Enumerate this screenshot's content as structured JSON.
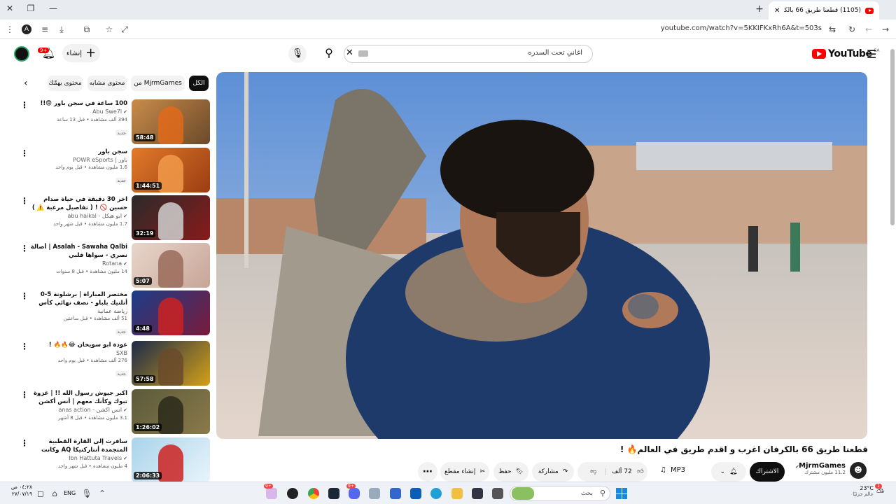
{
  "browser": {
    "tab_title": "(1105) قطعنا طريق 66 بالكرفان",
    "url": "youtube.com/watch?v=5KKIFKxRh6A&t=503s",
    "window_controls": [
      "minimize-icon",
      "restore-icon",
      "close-icon"
    ]
  },
  "header": {
    "logo_text": "YouTube",
    "region": "SA",
    "search_value": "اغاني تحت السدره",
    "create_label": "إنشاء",
    "notifications_count": "9+"
  },
  "chips": [
    "الكل",
    "من MjrmGames",
    "محتوى مشابه",
    "محتوى يهمّك"
  ],
  "sidebar": [
    {
      "title": "100 ساعة في سجن باور 😨!!",
      "channel": "Abu Swe7l",
      "verified": true,
      "stats": "394 ألف مشاهدة • قبل 13 ساعة",
      "badge": "جديد",
      "duration": "58:48",
      "colors": [
        "#c98b4a",
        "#6b4a2a",
        "#e06a1a"
      ]
    },
    {
      "title": "سجن باور",
      "channel": "باور | POWR eSports",
      "verified": false,
      "stats": "1.6 مليون مشاهدة • قبل يوم واحد",
      "badge": "جديد",
      "duration": "1:44:51",
      "colors": [
        "#e27a2a",
        "#9a3d12",
        "#f19a4a"
      ]
    },
    {
      "title": "اخر 30 دقيقة في حياة صدام حسين 🚫 ! ( تفاصيل مرعبة ⚠️ )",
      "channel": "ابو هيكل - abu haikal",
      "verified": true,
      "stats": "1.7 مليون مشاهدة • قبل شهر واحد",
      "badge": "",
      "duration": "32:19",
      "colors": [
        "#2a2a2a",
        "#8a1a1a",
        "#d0d0d0"
      ]
    },
    {
      "title": "Asalah - Sawaha Qalbi | أصالة نصري - سواها قلبي",
      "channel": "Rotana",
      "verified": true,
      "stats": "14 مليون مشاهدة • قبل 8 سنوات",
      "badge": "",
      "duration": "5:07",
      "colors": [
        "#e8d6cc",
        "#c7a596",
        "#9a6b5a"
      ]
    },
    {
      "title": "مختصر المباراة | برشلونة 5-0 أتلتيك بلباو - نصف نهائي كأس السوبر الإسباني",
      "channel": "رياضة عمانية",
      "verified": false,
      "stats": "51 ألف مشاهدة • قبل ساعتين",
      "badge": "جديد",
      "duration": "4:48",
      "colors": [
        "#1b3d8a",
        "#7a1a3a",
        "#c22"
      ]
    },
    {
      "title": "عودة ابو سويحان 😂🔥🔥 !",
      "channel": "SXB",
      "verified": false,
      "stats": "276 ألف مشاهدة • قبل يوم واحد",
      "badge": "جديد",
      "duration": "57:58",
      "colors": [
        "#1a2a4a",
        "#d4a017",
        "#6a4a2a"
      ]
    },
    {
      "title": "اكبر جيوش رسول الله !! | غزوة تبوك وكأنك معهم | أنس أكشن",
      "channel": "انس اكشن - anas action",
      "verified": true,
      "stats": "3.1 مليون مشاهدة • قبل 8 أشهر",
      "badge": "",
      "duration": "1:26:02",
      "colors": [
        "#5a5a3a",
        "#8a7a4a",
        "#2a2a1a"
      ]
    },
    {
      "title": "سافرت إلى القارة القطبية المتجمدة أنتاركتيكا AQ وكانت التجربة كاملة",
      "channel": "Ibn Hattuta Travels",
      "verified": true,
      "stats": "4 مليون مشاهدة • قبل شهر واحد",
      "badge": "",
      "duration": "2:06:33",
      "colors": [
        "#a9d4ea",
        "#e8f4fa",
        "#c22"
      ]
    }
  ],
  "video": {
    "title": "قطعنا طريق 66 بالكرفان اغرب و اقدم طريق في العالم🔥 !",
    "channel": "MjrmGames",
    "subscribers": "11.2 مليون مشترك",
    "subscribe_label": "الاشتراك",
    "mp3_label": "MP3",
    "likes": "72 ألف",
    "share_label": "مشاركة",
    "save_label": "حفظ",
    "clip_label": "إنشاء مقطع"
  },
  "taskbar": {
    "search_placeholder": "بحث",
    "weather_temp": "23°C",
    "weather_desc": "عالم جزئيًا",
    "weather_badge": "1",
    "lang": "ENG",
    "time": "٠٤:٢٨ ص",
    "date": "٢٧/٠٧/١٩",
    "badges": [
      "9+",
      "9+"
    ]
  }
}
